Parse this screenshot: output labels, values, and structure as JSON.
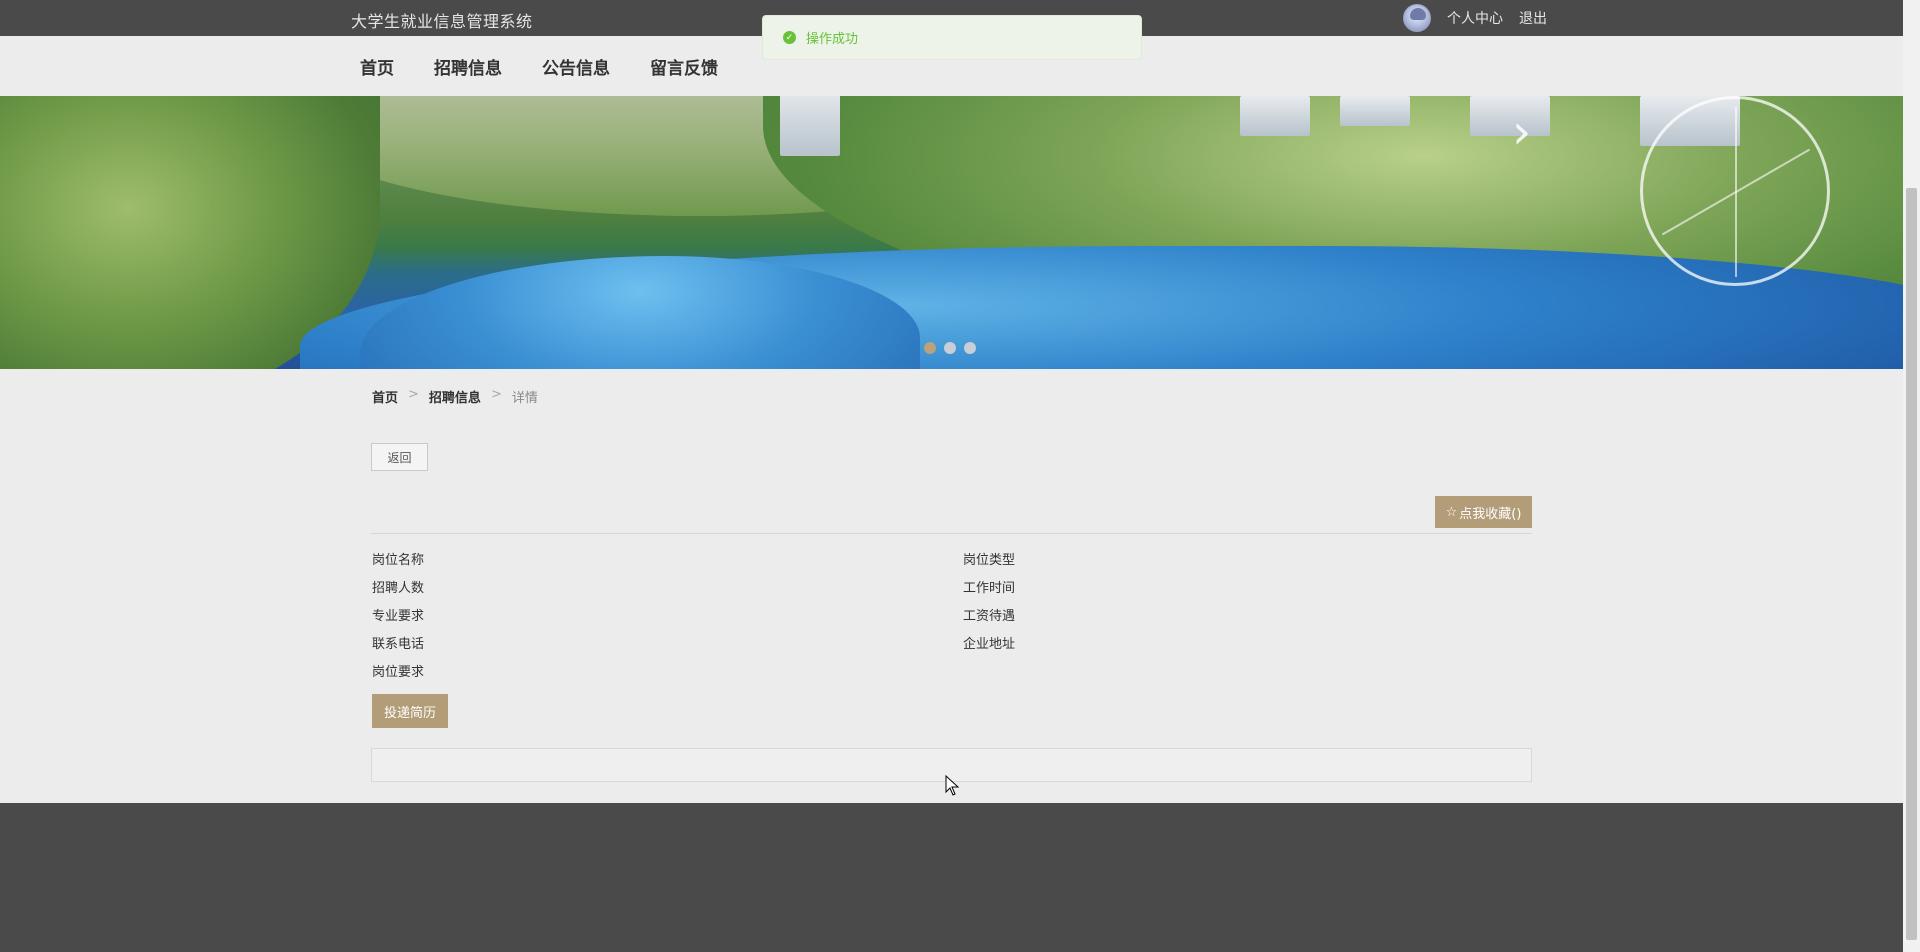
{
  "header": {
    "site_title": "大学生就业信息管理系统",
    "user_center": "个人中心",
    "logout": "退出"
  },
  "nav": {
    "items": [
      "首页",
      "招聘信息",
      "公告信息",
      "留言反馈"
    ]
  },
  "banner": {
    "slides": 3,
    "active_slide": 1,
    "next_arrow": "›"
  },
  "breadcrumb": {
    "home": "首页",
    "section": "招聘信息",
    "current": "详情",
    "separator": ">"
  },
  "detail": {
    "back_label": "返回",
    "favorite_label": "点我收藏()",
    "favorite_icon": "☆",
    "fields_left": [
      "岗位名称",
      "招聘人数",
      "专业要求",
      "联系电话",
      "岗位要求"
    ],
    "fields_right": [
      "岗位类型",
      "工作时间",
      "工资待遇",
      "企业地址"
    ],
    "apply_label": "投递简历"
  },
  "toast": {
    "message": "操作成功",
    "icon": "✓"
  },
  "colors": {
    "accent": "#b29d78",
    "dark_bar": "#4a4a4a",
    "success": "#67c23a"
  }
}
